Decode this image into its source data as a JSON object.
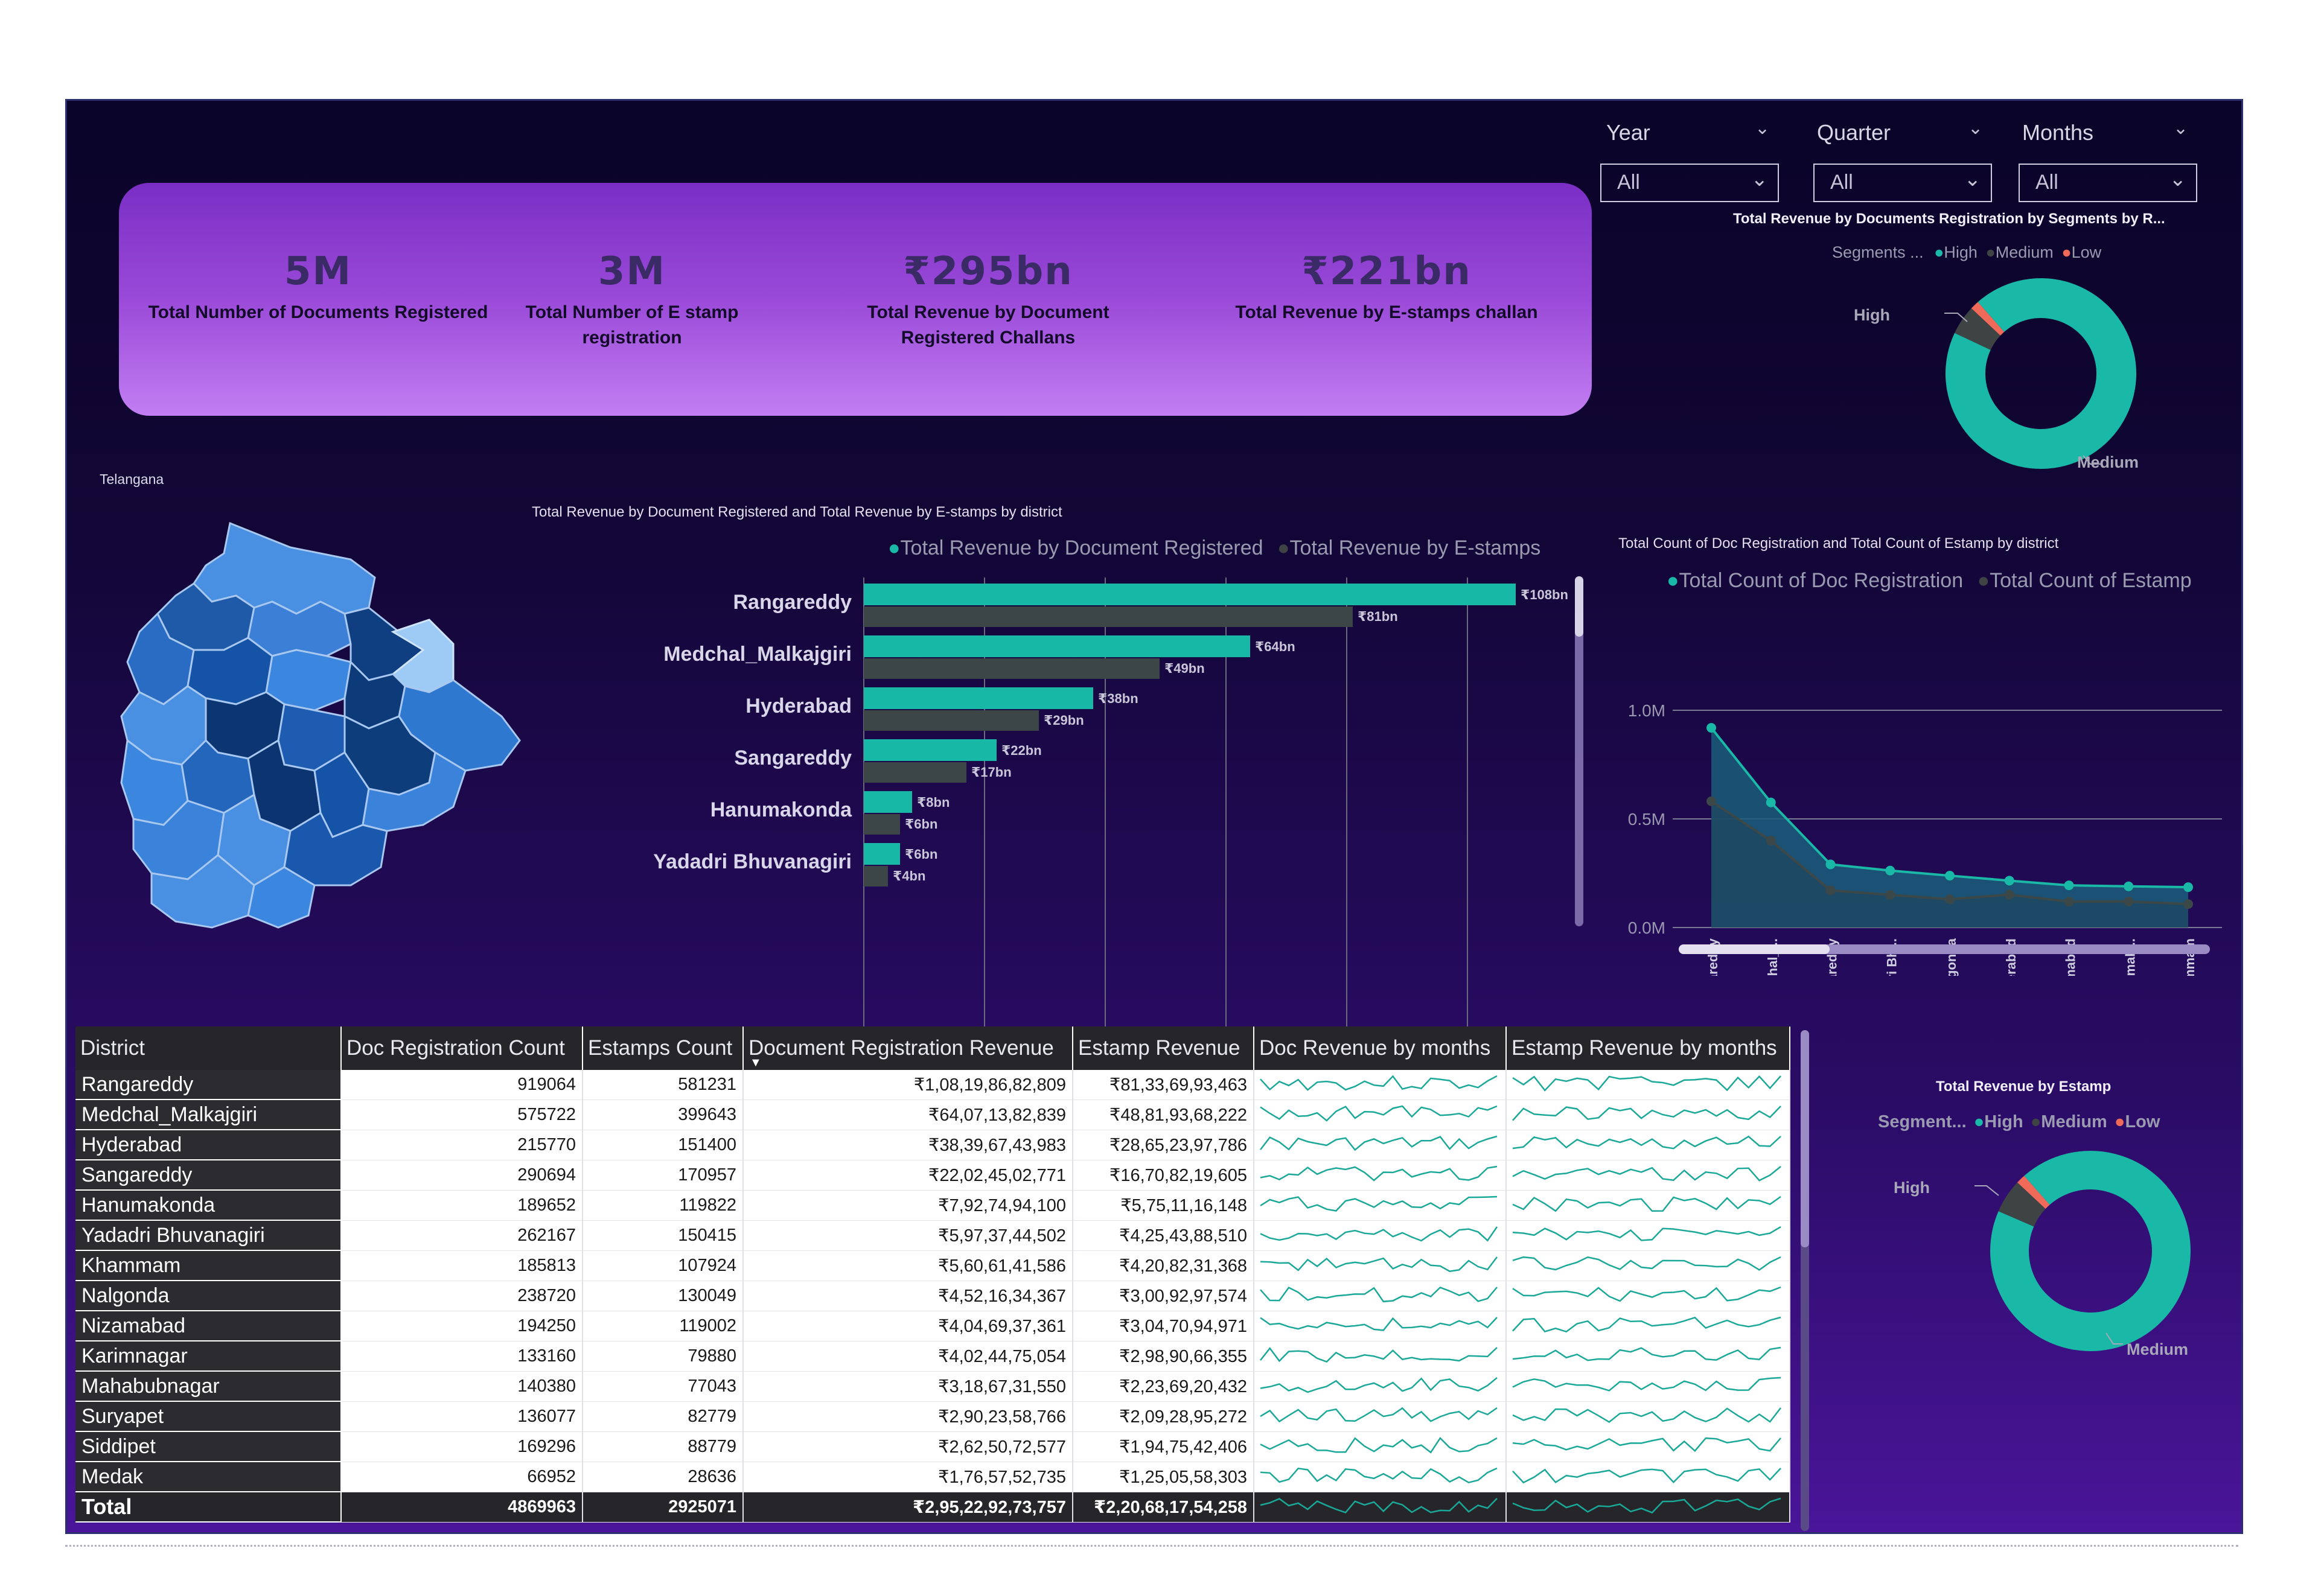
{
  "slicers": [
    {
      "label": "Year",
      "value": "All"
    },
    {
      "label": "Quarter",
      "value": "All"
    },
    {
      "label": "Months",
      "value": "All"
    }
  ],
  "kpis": [
    {
      "value": "5M",
      "label": "Total Number of Documents Registered"
    },
    {
      "value": "3M",
      "label": "Total Number of E stamp registration"
    },
    {
      "value": "₹295bn",
      "label": "Total Revenue by Document Registered Challans"
    },
    {
      "value": "₹221bn",
      "label": "Total Revenue by E-stamps challan"
    }
  ],
  "map": {
    "title": "Telangana"
  },
  "donut_top": {
    "title": "Total Revenue by Documents Registration by Segments by R...",
    "legend_title": "Segments ...",
    "legend": [
      "High",
      "Medium",
      "Low"
    ],
    "label_high": "High",
    "label_medium": "Medium"
  },
  "donut_bottom": {
    "title": "Total Revenue by Estamp",
    "legend_title": "Segment...",
    "legend": [
      "High",
      "Medium",
      "Low"
    ],
    "label_high": "High",
    "label_medium": "Medium"
  },
  "colors": {
    "teal": "#1ab8a6",
    "dark": "#3e4444",
    "red": "#f06a5a",
    "purple": "#7a2ec4"
  },
  "chart_data": [
    {
      "type": "bar",
      "title": "Total Revenue by Document Registered  and Total Revenue by E-stamps by district",
      "categories": [
        "Rangareddy",
        "Medchal_Malkajgiri",
        "Hyderabad",
        "Sangareddy",
        "Hanumakonda",
        "Yadadri Bhuvanagiri"
      ],
      "series": [
        {
          "name": "Total Revenue by Document Registered",
          "values": [
            108,
            64,
            38,
            22,
            8,
            6
          ],
          "labels": [
            "₹108bn",
            "₹64bn",
            "₹38bn",
            "₹22bn",
            "₹8bn",
            "₹6bn"
          ]
        },
        {
          "name": "Total Revenue by E-stamps",
          "values": [
            81,
            49,
            29,
            17,
            6,
            4
          ],
          "labels": [
            "₹81bn",
            "₹49bn",
            "₹29bn",
            "₹17bn",
            "₹6bn",
            "₹4bn"
          ]
        }
      ],
      "ticks": [
        "₹0bn",
        "₹20bn",
        "₹40bn",
        "₹60bn",
        "₹80bn",
        "₹100bn"
      ],
      "xlim": [
        0,
        120
      ],
      "grid": true,
      "legend_position": "top"
    },
    {
      "type": "area",
      "title": "Total Count of Doc Registration  and Total Count of Estamp  by district",
      "categories": [
        "Rangareddy",
        "Medchal_...",
        "Sangareddy",
        "Yadadri Bh...",
        "Nalgonda",
        "Hyderabad",
        "Nizamabad",
        "Hanumak...",
        "Khammam"
      ],
      "series": [
        {
          "name": "Total Count of Doc Registration",
          "values": [
            919064,
            575722,
            290694,
            262167,
            238720,
            215770,
            194250,
            189652,
            185813
          ]
        },
        {
          "name": "Total Count of Estamp",
          "values": [
            581231,
            399643,
            170957,
            150415,
            130049,
            151400,
            119002,
            119822,
            107924
          ]
        }
      ],
      "ticks": [
        "1.0M",
        "0.5M",
        "0.0M"
      ],
      "ylim": [
        0,
        1000000
      ],
      "grid": true,
      "legend_position": "top"
    },
    {
      "type": "pie",
      "title": "Total Revenue by Documents Registration by Segments by R...",
      "categories": [
        "High",
        "Medium",
        "Low"
      ],
      "values": [
        93.5,
        5,
        1.5
      ]
    },
    {
      "type": "pie",
      "title": "Total Revenue by Estamp",
      "categories": [
        "High",
        "Medium",
        "Low"
      ],
      "values": [
        93,
        5.5,
        1.5
      ]
    }
  ],
  "table": {
    "headers": [
      "District",
      "Doc Registration Count",
      "Estamps Count",
      "Document Registration Revenue",
      "Estamp Revenue",
      "Doc Revenue by months",
      "Estamp Revenue by months"
    ],
    "rows": [
      [
        "Rangareddy",
        "919064",
        "581231",
        "₹1,08,19,86,82,809",
        "₹81,33,69,93,463"
      ],
      [
        "Medchal_Malkajgiri",
        "575722",
        "399643",
        "₹64,07,13,82,839",
        "₹48,81,93,68,222"
      ],
      [
        "Hyderabad",
        "215770",
        "151400",
        "₹38,39,67,43,983",
        "₹28,65,23,97,786"
      ],
      [
        "Sangareddy",
        "290694",
        "170957",
        "₹22,02,45,02,771",
        "₹16,70,82,19,605"
      ],
      [
        "Hanumakonda",
        "189652",
        "119822",
        "₹7,92,74,94,100",
        "₹5,75,11,16,148"
      ],
      [
        "Yadadri Bhuvanagiri",
        "262167",
        "150415",
        "₹5,97,37,44,502",
        "₹4,25,43,88,510"
      ],
      [
        "Khammam",
        "185813",
        "107924",
        "₹5,60,61,41,586",
        "₹4,20,82,31,368"
      ],
      [
        "Nalgonda",
        "238720",
        "130049",
        "₹4,52,16,34,367",
        "₹3,00,92,97,574"
      ],
      [
        "Nizamabad",
        "194250",
        "119002",
        "₹4,04,69,37,361",
        "₹3,04,70,94,971"
      ],
      [
        "Karimnagar",
        "133160",
        "79880",
        "₹4,02,44,75,054",
        "₹2,98,90,66,355"
      ],
      [
        "Mahabubnagar",
        "140380",
        "77043",
        "₹3,18,67,31,550",
        "₹2,23,69,20,432"
      ],
      [
        "Suryapet",
        "136077",
        "82779",
        "₹2,90,23,58,766",
        "₹2,09,28,95,272"
      ],
      [
        "Siddipet",
        "169296",
        "88779",
        "₹2,62,50,72,577",
        "₹1,94,75,42,406"
      ],
      [
        "Medak",
        "66952",
        "28636",
        "₹1,76,57,52,735",
        "₹1,25,05,58,303"
      ]
    ],
    "total": [
      "Total",
      "4869963",
      "2925071",
      "₹2,95,22,92,73,757",
      "₹2,20,68,17,54,258"
    ]
  }
}
